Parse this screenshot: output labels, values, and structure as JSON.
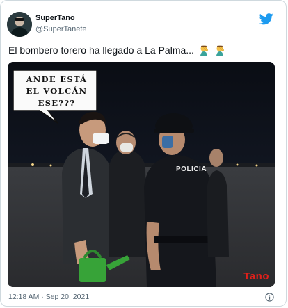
{
  "author": {
    "display_name": "SuperTano",
    "handle": "@SuperTanete"
  },
  "tweet": {
    "text": "El bombero torero ha llegado a La Palma...",
    "emoji": [
      "man-facepalming-emoji",
      "man-facepalming-emoji"
    ]
  },
  "media": {
    "speech_bubble_text": "ANDE ESTÁ EL VOLCÁN ESE???",
    "police_vest_text": "POLICIA",
    "watermark": "Tano"
  },
  "footer": {
    "timestamp": "12:18 AM · Sep 20, 2021"
  },
  "colors": {
    "twitter_blue": "#1d9bf0",
    "watermark_red": "#e0201a",
    "secondary_text": "#536471"
  }
}
